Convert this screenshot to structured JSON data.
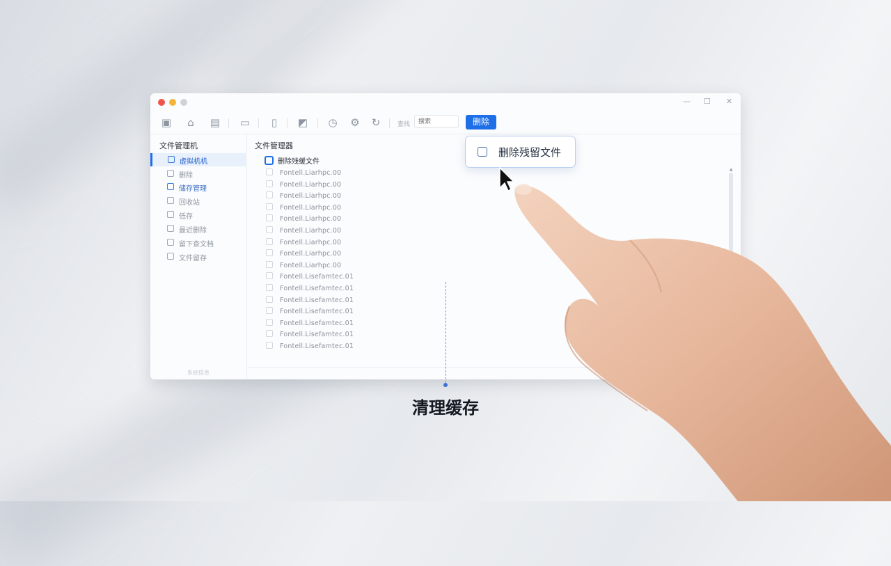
{
  "window": {
    "controls": {
      "minimize": "—",
      "maximize": "☐",
      "close": "✕"
    }
  },
  "toolbar": {
    "search_label": "查找",
    "search_placeholder": "搜索",
    "delete_button": "删除"
  },
  "sidebar": {
    "title": "文件管理机",
    "items": [
      {
        "label": "虚拟机机"
      },
      {
        "label": "删除"
      },
      {
        "label": "储存管理"
      },
      {
        "label": "回收站"
      },
      {
        "label": "低存"
      },
      {
        "label": "最近删除"
      },
      {
        "label": "留下查文档"
      },
      {
        "label": "文件留存"
      }
    ],
    "footer": "系统信息"
  },
  "main": {
    "title": "文件管理器",
    "group_label": "删除残缓文件",
    "files": [
      "Fontell.Liarhpc.00",
      "Fontell.Liarhpc.00",
      "Fontell.Liarhpc.00",
      "Fontell.Liarhpc.00",
      "Fontell.Liarhpc.00",
      "Fontell.Liarhpc.00",
      "Fontell.Liarhpc.00",
      "Fontell.Liarhpc.00",
      "Fontell.Liarhpc.00",
      "Fontell.Lisefamtec.01",
      "Fontell.Lisefamtec.01",
      "Fontell.Lisefamtec.01",
      "Fontell.Lisefamtec.01",
      "Fontell.Lisefamtec.01",
      "Fontell.Lisefamtec.01",
      "Fontell.Lisefamtec.01"
    ]
  },
  "popup": {
    "label": "删除残留文件"
  },
  "caption": "清理缓存",
  "colors": {
    "accent": "#1e6ee8",
    "close_dot": "#f0554a",
    "min_dot": "#f5b33a",
    "max_dot": "#cfd3d8"
  }
}
